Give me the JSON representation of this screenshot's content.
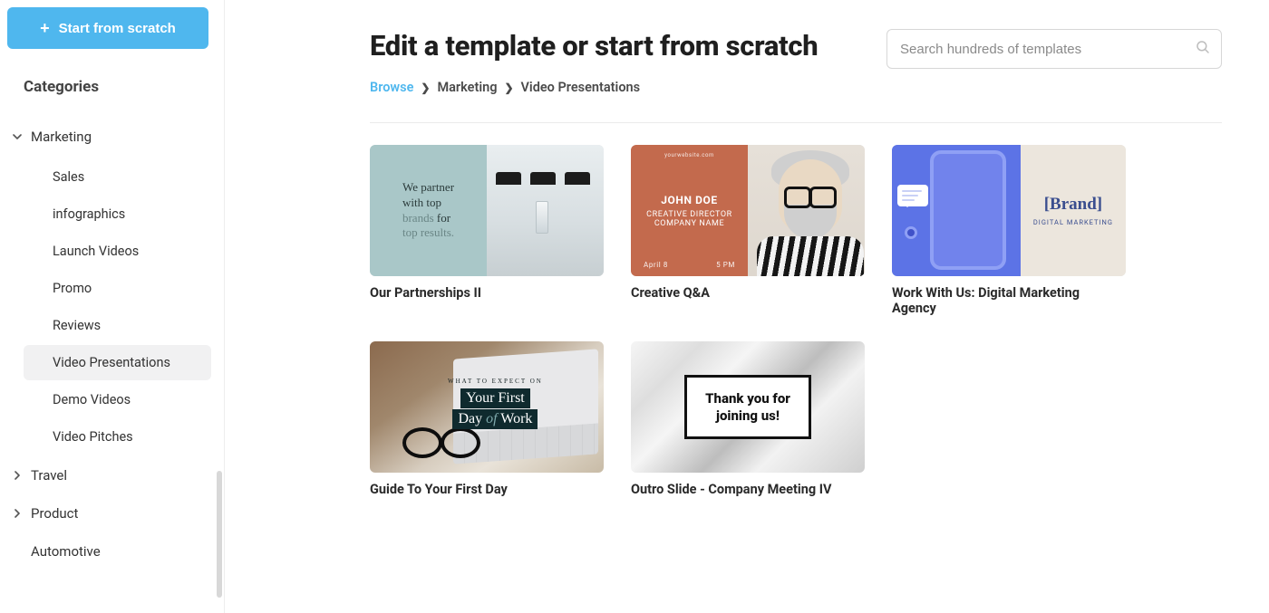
{
  "sidebar": {
    "start_button": "Start from scratch",
    "categories_heading": "Categories",
    "categories": [
      {
        "label": "Marketing",
        "expanded": true,
        "children": [
          {
            "label": "Sales"
          },
          {
            "label": "infographics"
          },
          {
            "label": "Launch Videos"
          },
          {
            "label": "Promo"
          },
          {
            "label": "Reviews"
          },
          {
            "label": "Video Presentations",
            "active": true
          },
          {
            "label": "Demo Videos"
          },
          {
            "label": "Video Pitches"
          }
        ]
      },
      {
        "label": "Travel",
        "expanded": false
      },
      {
        "label": "Product",
        "expanded": false
      },
      {
        "label": "Automotive",
        "expanded": false
      }
    ]
  },
  "header": {
    "title": "Edit a template or start from scratch",
    "search_placeholder": "Search hundreds of templates"
  },
  "breadcrumb": {
    "root": "Browse",
    "mid": "Marketing",
    "leaf": "Video Presentations"
  },
  "templates": [
    {
      "title": "Our Partnerships II",
      "thumb": {
        "line1a": "We partner",
        "line2a": "with top",
        "line2b": "brands",
        "line3a": "for",
        "line4a": "top results."
      }
    },
    {
      "title": "Creative Q&A",
      "thumb": {
        "tiny": "yourwebsite.com",
        "name": "JOHN DOE",
        "role": "CREATIVE DIRECTOR",
        "company": "COMPANY NAME",
        "foot_l": "April 8",
        "foot_r": "5 PM"
      }
    },
    {
      "title": "Work With Us: Digital Marketing Agency",
      "thumb": {
        "brand": "[Brand]",
        "tag": "DIGITAL MARKETING"
      }
    },
    {
      "title": "Guide To Your First Day",
      "thumb": {
        "small": "WHAT TO EXPECT ON",
        "line1": "Your First",
        "line2a": "Day",
        "line2of": "of",
        "line2b": "Work"
      }
    },
    {
      "title": "Outro Slide - Company Meeting IV",
      "thumb": {
        "line1": "Thank you for",
        "line2": "joining us!"
      }
    }
  ]
}
